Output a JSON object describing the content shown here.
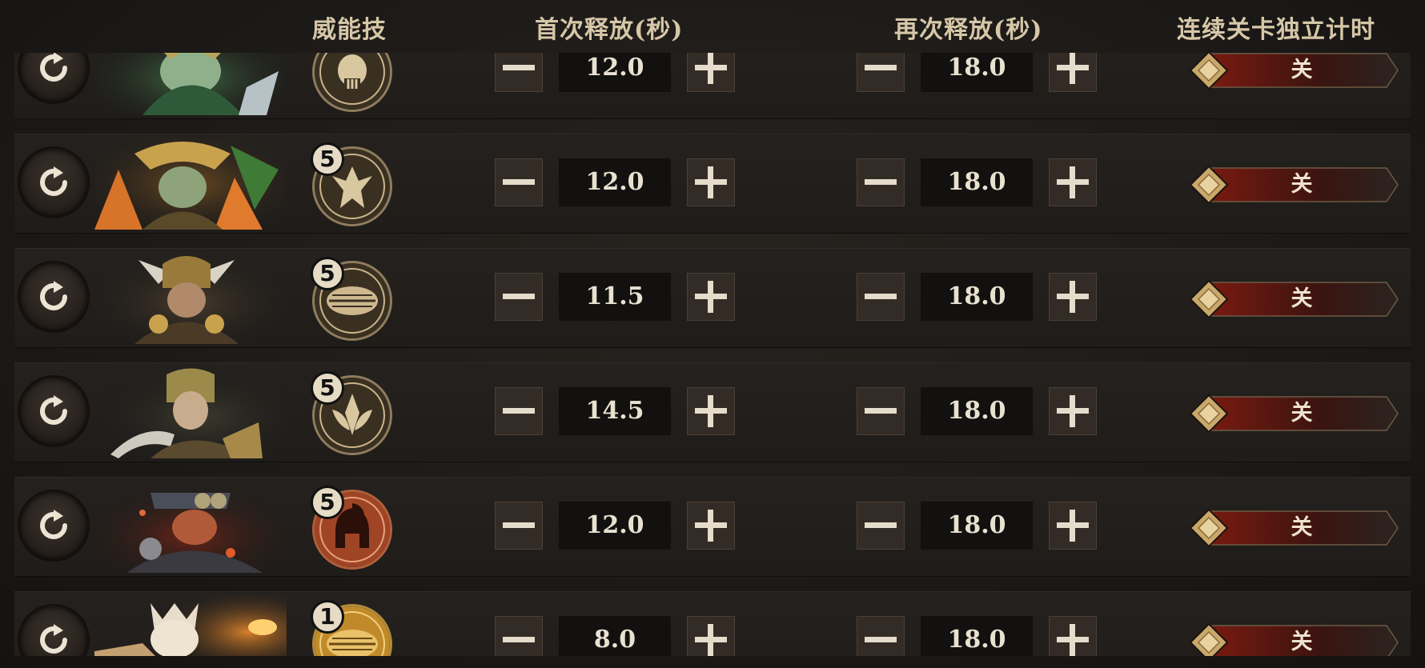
{
  "header": {
    "skill": "威能技",
    "first_release": "首次释放(秒)",
    "repeat_release": "再次释放(秒)",
    "independent_timer": "连续关卡独立计时"
  },
  "rows": [
    {
      "portrait": "hero-green-sorceress-portrait",
      "skill_level": "",
      "skill_icon": "skull-emblem-icon",
      "first": "12.0",
      "repeat": "18.0",
      "toggle": "关"
    },
    {
      "portrait": "hero-flame-dryad-portrait",
      "skill_level": "5",
      "skill_icon": "winged-figure-emblem-icon",
      "first": "12.0",
      "repeat": "18.0",
      "toggle": "关"
    },
    {
      "portrait": "hero-horned-dwarf-portrait",
      "skill_level": "5",
      "skill_icon": "blade-emblem-icon",
      "first": "11.5",
      "repeat": "18.0",
      "toggle": "关"
    },
    {
      "portrait": "hero-elf-knight-portrait",
      "skill_level": "5",
      "skill_icon": "lily-emblem-icon",
      "first": "14.5",
      "repeat": "18.0",
      "toggle": "关"
    },
    {
      "portrait": "hero-goggled-engineer-portrait",
      "skill_level": "5",
      "skill_icon": "spartan-helmet-icon",
      "first": "12.0",
      "repeat": "18.0",
      "toggle": "关"
    },
    {
      "portrait": "hero-white-cat-portrait",
      "skill_level": "1",
      "skill_icon": "gold-blade-emblem-icon",
      "first": "8.0",
      "repeat": "18.0",
      "toggle": "关"
    }
  ],
  "colors": {
    "header_text": "#d6c7a8",
    "toggle_red": "#6d1810",
    "gold_accent": "#c9a86a"
  }
}
